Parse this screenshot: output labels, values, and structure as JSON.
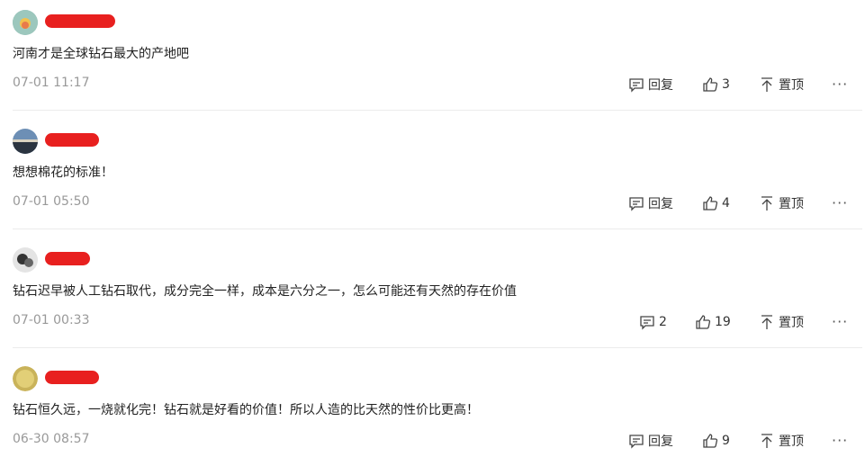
{
  "comments": [
    {
      "content": "河南才是全球钻石最大的产地吧",
      "time": "07-01 11:17",
      "reply_label": "回复",
      "likes": "3",
      "pin_label": "置顶",
      "more": "···"
    },
    {
      "content": "想想棉花的标准！",
      "time": "07-01 05:50",
      "reply_label": "回复",
      "likes": "4",
      "pin_label": "置顶",
      "more": "···"
    },
    {
      "content": "钻石迟早被人工钻石取代，成分完全一样，成本是六分之一，怎么可能还有天然的存在价值",
      "time": "07-01 00:33",
      "reply_label": "2",
      "likes": "19",
      "pin_label": "置顶",
      "more": "···"
    },
    {
      "content": "钻石恒久远，一烧就化完！钻石就是好看的价值！所以人造的比天然的性价比更高！",
      "time": "06-30 08:57",
      "reply_label": "回复",
      "likes": "9",
      "pin_label": "置顶",
      "more": "···"
    }
  ],
  "colors": {
    "redaction": "#e8201f",
    "time": "#999999",
    "divider": "#ececec"
  }
}
